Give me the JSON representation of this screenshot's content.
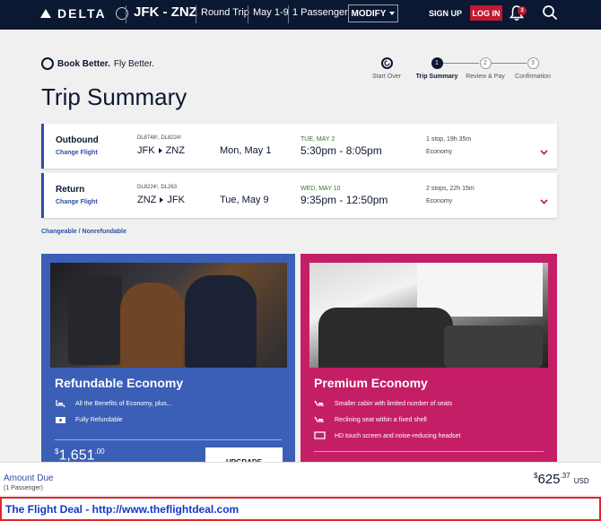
{
  "header": {
    "logo": "DELTA",
    "route": "JFK - ZNZ",
    "trip_type": "Round Trip",
    "dates": "May 1-9",
    "passengers": "1 Passenger",
    "modify_label": "MODIFY",
    "signup_label": "SIGN UP",
    "login_label": "LOG IN",
    "notification_count": "3"
  },
  "brand": {
    "tagline_bold": "Book Better.",
    "tagline_rest": " Fly Better."
  },
  "page_title": "Trip Summary",
  "steps": [
    {
      "label": "Start Over"
    },
    {
      "number": "1",
      "label": "Trip Summary"
    },
    {
      "number": "2",
      "label": "Review & Pay"
    },
    {
      "number": "3",
      "label": "Confirmation"
    }
  ],
  "flights": [
    {
      "direction": "Outbound",
      "change_label": "Change Flight",
      "flight_numbers": "DL8748¹, DL8224¹",
      "origin": "JFK",
      "destination": "ZNZ",
      "date": "Mon, May 1",
      "arrival_label": "TUE, MAY 2",
      "times": "5:30pm - 8:05pm",
      "stops": "1 stop, 19h 35m",
      "cabin": "Economy"
    },
    {
      "direction": "Return",
      "change_label": "Change Flight",
      "flight_numbers": "DL8224¹, DL263",
      "origin": "ZNZ",
      "destination": "JFK",
      "date": "Tue, May 9",
      "arrival_label": "WED, MAY 10",
      "times": "9:35pm - 12:50pm",
      "stops": "2 stops,  22h 15m",
      "cabin": "Economy"
    }
  ],
  "fare_policy": "Changeable / Nonrefundable",
  "fares": [
    {
      "title": "Refundable Economy",
      "features": [
        "All the Benefits of Economy, plus...",
        "Fully Refundable"
      ],
      "price_dollars": "1,651",
      "price_cents": ".00",
      "button_label": "UPGRADE"
    },
    {
      "title": "Premium Economy",
      "features": [
        "Smaller cabin with limited number of seats",
        "Reclining seat within a fixed shell",
        "HD touch screen and noise-reducing headset"
      ]
    }
  ],
  "amount": {
    "label": "Amount Due",
    "passengers": "(1 Passenger)",
    "currency_symbol": "$",
    "dollars": "625",
    "cents": ".37",
    "currency": "USD"
  },
  "watermark": "The Flight Deal - http://www.theflightdeal.com",
  "colors": {
    "navy": "#0b1831",
    "accent_red": "#c01933",
    "economy_blue": "#3b5fb6",
    "premium_pink": "#c41f66",
    "link_blue": "#2d4ea3"
  }
}
